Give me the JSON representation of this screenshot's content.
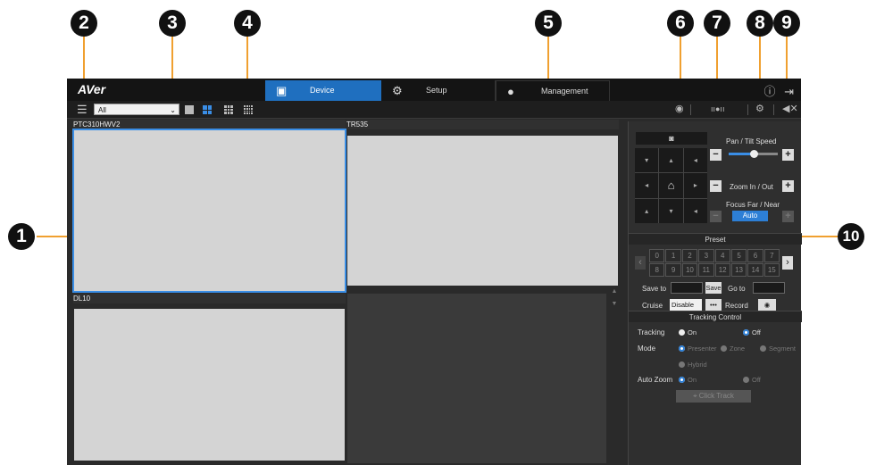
{
  "callouts": [
    "1",
    "2",
    "3",
    "4",
    "5",
    "6",
    "7",
    "8",
    "9",
    "10"
  ],
  "app": {
    "logo": "AVer",
    "tabs": [
      {
        "label": "Device",
        "icon": "camera-tab-icon",
        "active": true
      },
      {
        "label": "Setup",
        "icon": "gear-icon",
        "active": false
      },
      {
        "label": "Management",
        "icon": "user-icon",
        "active": false
      }
    ],
    "top_icons": {
      "info": "ⓘ",
      "logout": "⇥"
    }
  },
  "toolbar": {
    "group_select": "All",
    "layouts": [
      "1x1",
      "2x2",
      "3x3",
      "4x4"
    ],
    "selected_layout": "2x2"
  },
  "panes": [
    {
      "label": "PTC310HWV2",
      "selected": true
    },
    {
      "label": "TR535",
      "selected": false
    },
    {
      "label": "DL10",
      "selected": false
    }
  ],
  "ptz": {
    "snapshot_icon": "camera-icon",
    "pan_tilt_label": "Pan / Tilt Speed",
    "zoom_label": "Zoom In / Out",
    "focus_label": "Focus Far / Near",
    "auto_label": "Auto",
    "minus": "−",
    "plus": "+"
  },
  "preset": {
    "title": "Preset",
    "numbers": [
      "0",
      "1",
      "2",
      "3",
      "4",
      "5",
      "6",
      "7",
      "8",
      "9",
      "10",
      "11",
      "12",
      "13",
      "14",
      "15"
    ],
    "save_to_label": "Save to",
    "save_btn": "Save",
    "go_to_label": "Go to",
    "cruise_label": "Cruise",
    "cruise_value": "Disable",
    "dots_btn": "•••",
    "record_label": "Record"
  },
  "tracking": {
    "title": "Tracking Control",
    "tracking_label": "Tracking",
    "on": "On",
    "off": "Off",
    "mode_label": "Mode",
    "presenter": "Presenter",
    "zone": "Zone",
    "segment": "Segment",
    "hybrid": "Hybrid",
    "auto_zoom_label": "Auto Zoom",
    "click_track": "Click Track"
  },
  "colors": {
    "accent": "#1f6fbf",
    "callout_line": "#f0a030"
  }
}
